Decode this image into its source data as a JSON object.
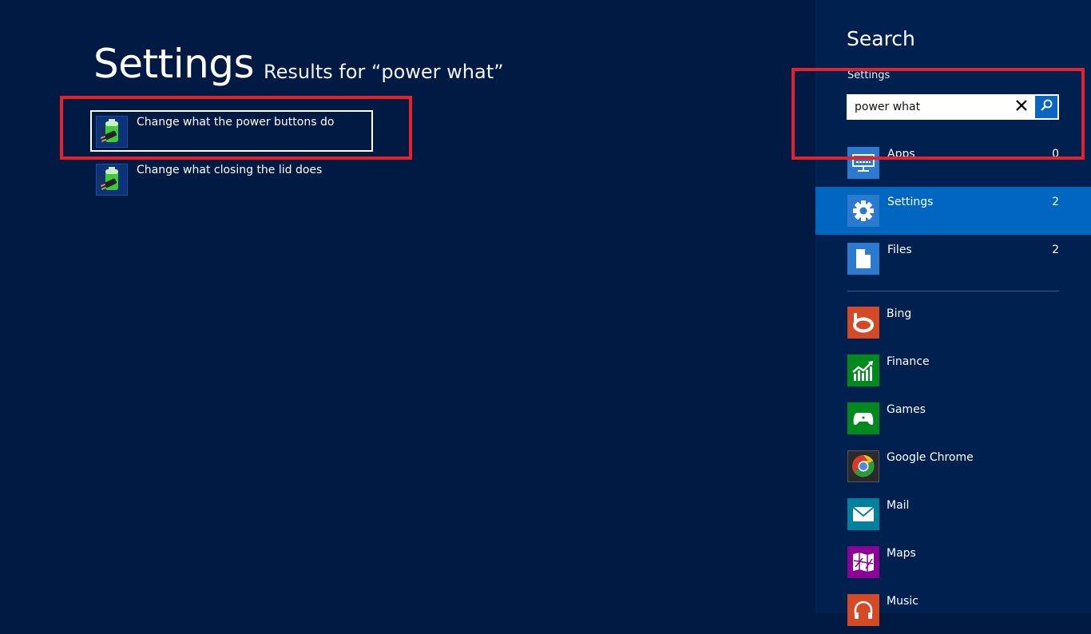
{
  "main": {
    "title": "Settings",
    "results_for": "Results for “power what”",
    "results": [
      {
        "label": "Change what the power buttons do",
        "icon": "battery-power-plug-icon",
        "focused": true
      },
      {
        "label": "Change what closing the lid does",
        "icon": "battery-power-plug-icon",
        "focused": false
      }
    ]
  },
  "charm": {
    "title": "Search",
    "scope_label": "Settings",
    "search": {
      "value": "power what",
      "placeholder": ""
    },
    "categories": [
      {
        "label": "Apps",
        "count": "0",
        "icon": "apps-monitor-icon",
        "color": "#2b7ad0"
      },
      {
        "label": "Settings",
        "count": "2",
        "icon": "gear-icon",
        "color": "#2b7ad0",
        "selected": true
      },
      {
        "label": "Files",
        "count": "2",
        "icon": "file-icon",
        "color": "#2b7ad0"
      }
    ],
    "apps": [
      {
        "label": "Bing",
        "icon": "bing-icon",
        "color": "#d44a26"
      },
      {
        "label": "Finance",
        "icon": "finance-chart-icon",
        "color": "#00891c"
      },
      {
        "label": "Games",
        "icon": "gamepad-icon",
        "color": "#00891c"
      },
      {
        "label": "Google Chrome",
        "icon": "chrome-icon",
        "color": "#2a2a2a"
      },
      {
        "label": "Mail",
        "icon": "mail-envelope-icon",
        "color": "#00829c"
      },
      {
        "label": "Maps",
        "icon": "maps-icon",
        "color": "#8c0095"
      },
      {
        "label": "Music",
        "icon": "headphones-icon",
        "color": "#d44a26"
      }
    ]
  },
  "colors": {
    "background": "#001a44",
    "charm_background": "#002050",
    "selected": "#0067c0",
    "annotation_red": "#e8202a"
  }
}
